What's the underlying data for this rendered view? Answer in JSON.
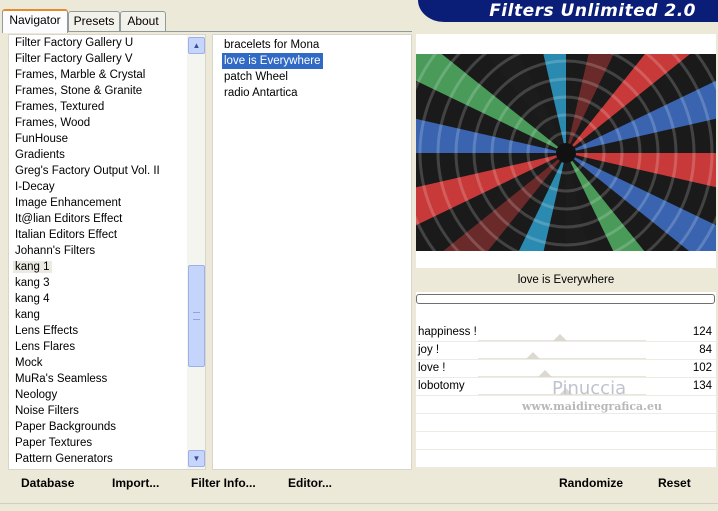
{
  "app": {
    "title": "Filters Unlimited 2.0"
  },
  "tabs": [
    {
      "label": "Navigator",
      "active": true
    },
    {
      "label": "Presets",
      "active": false
    },
    {
      "label": "About",
      "active": false
    }
  ],
  "categories": {
    "items": [
      "Filter Factory Gallery U",
      "Filter Factory Gallery V",
      "Frames, Marble & Crystal",
      "Frames, Stone & Granite",
      "Frames, Textured",
      "Frames, Wood",
      "FunHouse",
      "Gradients",
      "Greg's Factory Output Vol. II",
      "I-Decay",
      "Image Enhancement",
      "It@lian Editors Effect",
      "Italian Editors Effect",
      "Johann's Filters",
      "kang 1",
      "kang 3",
      "kang 4",
      "kang",
      "Lens Effects",
      "Lens Flares",
      "Mock",
      "MuRa's Seamless",
      "Neology",
      "Noise Filters",
      "Paper Backgrounds",
      "Paper Textures",
      "Pattern Generators"
    ],
    "selected": "kang 1"
  },
  "filters": {
    "items": [
      "bracelets for Mona",
      "love is Everywhere",
      "patch Wheel",
      "radio Antartica"
    ],
    "selected": "love is Everywhere"
  },
  "preview": {
    "filter_name": "love is Everywhere"
  },
  "parameters": [
    {
      "name": "happiness !",
      "value": "124",
      "fraction": 0.486
    },
    {
      "name": "joy !",
      "value": "84",
      "fraction": 0.329
    },
    {
      "name": "love !",
      "value": "102",
      "fraction": 0.4
    },
    {
      "name": "lobotomy",
      "value": "134",
      "fraction": 0.525
    }
  ],
  "watermark": {
    "name": "Pinuccia",
    "site": "www.maidiregrafica.eu"
  },
  "buttons": {
    "database": "Database",
    "import": "Import...",
    "filter_info": "Filter Info...",
    "editor": "Editor...",
    "randomize": "Randomize",
    "reset": "Reset"
  },
  "colors": {
    "banner": "#0a1e78",
    "selection": "#316ac5",
    "face": "#ece9d8"
  }
}
